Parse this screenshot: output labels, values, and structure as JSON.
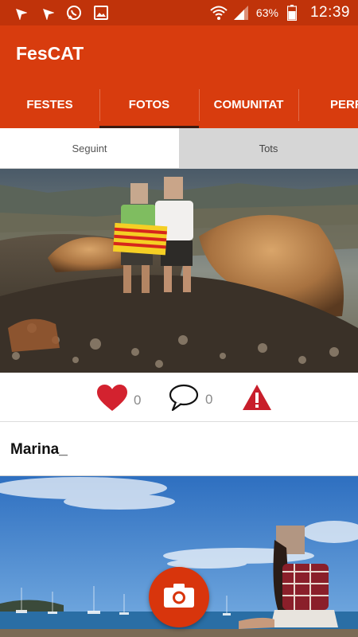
{
  "status_bar": {
    "left_icons": [
      "navigation-arrow-icon",
      "navigation-arrow-icon",
      "whatsapp-icon",
      "image-icon"
    ],
    "right_icons": [
      "wifi-icon",
      "signal-icon",
      "battery-icon"
    ],
    "battery_percent": "63%",
    "time": "12:39"
  },
  "app": {
    "title": "FesCAT",
    "accent_color": "#d83c0e"
  },
  "tabs": [
    {
      "label": "FESTES",
      "active": false
    },
    {
      "label": "FOTOS",
      "active": true
    },
    {
      "label": "COMUNITAT",
      "active": false
    },
    {
      "label": "PERF",
      "active": false
    }
  ],
  "filter": {
    "following": "Seguint",
    "all": "Tots",
    "selected": "Seguint"
  },
  "post": {
    "likes": "0",
    "comments": "0",
    "icons": [
      "heart-icon",
      "comment-icon",
      "report-warning-icon"
    ],
    "author": "Marina_"
  },
  "fab": {
    "icon": "camera-icon"
  }
}
